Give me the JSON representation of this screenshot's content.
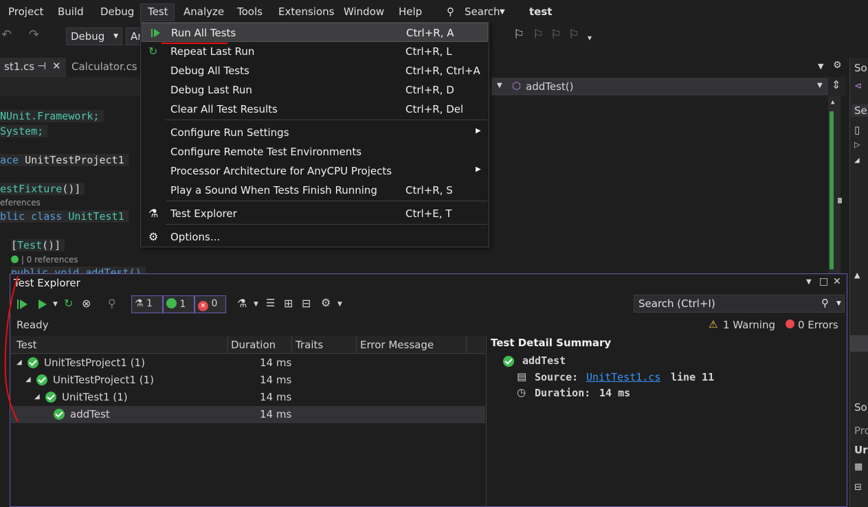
{
  "menubar": {
    "items": [
      "Project",
      "Build",
      "Debug",
      "Test",
      "Analyze",
      "Tools",
      "Extensions",
      "Window",
      "Help"
    ],
    "search": "Search",
    "solution_name": "test"
  },
  "toolbar": {
    "config": "Debug",
    "platform": "Ar"
  },
  "tabs": [
    {
      "label": "st1.cs"
    },
    {
      "label": "Calculator.cs"
    }
  ],
  "nav": {
    "member": "addTest()"
  },
  "code": {
    "line1": "NUnit.Framework;",
    "line2": "System;",
    "line3_kw": "ace",
    "line3_id": "UnitTestProject1",
    "line4_attr": "estFixture",
    "line4_rest": "()]",
    "ref1": "eferences",
    "line5_kw": "blic class",
    "line5_id": "UnitTest1",
    "line6_open": "[",
    "line6_attr": "Test",
    "line6_rest": "()]",
    "ref2": "| 0 references",
    "line7": "public void addTest()"
  },
  "test_menu": {
    "items": [
      {
        "label": "Run All Tests",
        "shortcut": "Ctrl+R, A"
      },
      {
        "label": "Repeat Last Run",
        "shortcut": "Ctrl+R, L"
      },
      {
        "label": "Debug All Tests",
        "shortcut": "Ctrl+R, Ctrl+A"
      },
      {
        "label": "Debug Last Run",
        "shortcut": "Ctrl+R, D"
      },
      {
        "label": "Clear All Test Results",
        "shortcut": "Ctrl+R, Del"
      },
      {
        "label": "Configure Run Settings",
        "shortcut": ""
      },
      {
        "label": "Configure Remote Test Environments",
        "shortcut": ""
      },
      {
        "label": "Processor Architecture for AnyCPU Projects",
        "shortcut": ""
      },
      {
        "label": "Play a Sound When Tests Finish Running",
        "shortcut": "Ctrl+R, S"
      },
      {
        "label": "Test Explorer",
        "shortcut": "Ctrl+E, T"
      },
      {
        "label": "Options...",
        "shortcut": ""
      }
    ]
  },
  "test_explorer": {
    "title": "Test Explorer",
    "counts": {
      "total": "1",
      "passed": "1",
      "failed": "0"
    },
    "search_placeholder": "Search (Ctrl+I)",
    "status": "Ready",
    "warnings": "1 Warning",
    "errors": "0 Errors",
    "columns": [
      "Test",
      "Duration",
      "Traits",
      "Error Message"
    ],
    "rows": [
      {
        "name": "UnitTestProject1  (1)",
        "duration": "14 ms"
      },
      {
        "name": "UnitTestProject1  (1)",
        "duration": "14 ms"
      },
      {
        "name": "UnitTest1  (1)",
        "duration": "14 ms"
      },
      {
        "name": "addTest",
        "duration": "14 ms"
      }
    ],
    "detail": {
      "title": "Test Detail Summary",
      "test_name": "addTest",
      "source_label": "Source:",
      "source_file": "UnitTest1.cs",
      "source_line": "line 11",
      "duration_label": "Duration:",
      "duration": "14 ms"
    }
  },
  "sidebar": {
    "items": [
      "Sol",
      "Se",
      "Sol",
      "Pro",
      "Ur"
    ]
  },
  "colors": {
    "accent": "#6b5bb5",
    "pass": "#3fb950",
    "fail": "#e5484d",
    "warn": "#f2c94c",
    "link": "#3794ff"
  }
}
